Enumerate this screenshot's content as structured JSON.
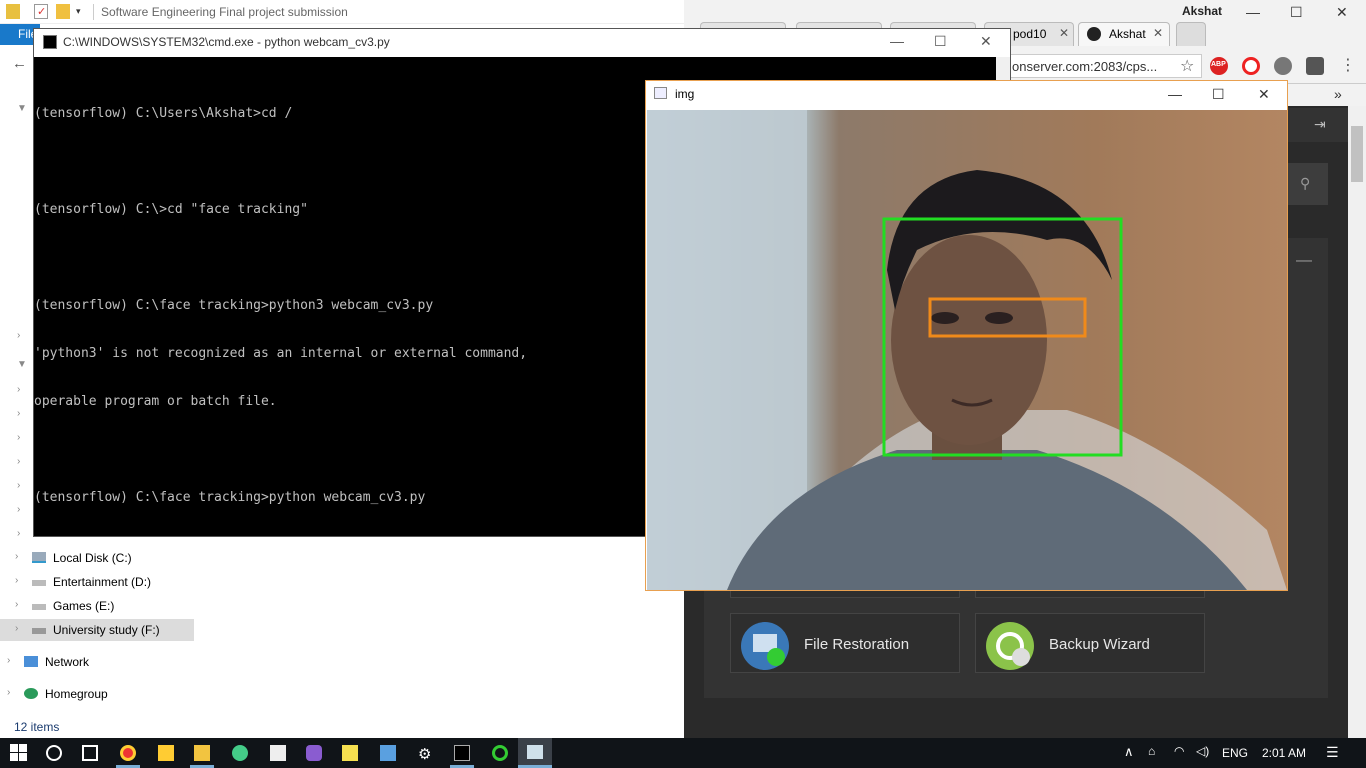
{
  "explorer": {
    "title": "Software Engineering Final project submission",
    "file_tab": "File",
    "status": "12 items",
    "nav": [
      {
        "label": "Local Disk (C:)"
      },
      {
        "label": "Entertainment (D:)"
      },
      {
        "label": "Games (E:)"
      },
      {
        "label": "University study (F:)"
      },
      {
        "label": "Network"
      },
      {
        "label": "Homegroup"
      }
    ]
  },
  "chrome": {
    "profile": "Akshat",
    "tabs": [
      {
        "label": "pod10"
      },
      {
        "label": "Akshat"
      }
    ],
    "address": "onserver.com:2083/cps...",
    "extensions": [
      "ABP"
    ],
    "overflow": "»",
    "cards": [
      {
        "label": "File Restoration",
        "icon": "file-restoration-icon"
      },
      {
        "label": "Backup Wizard",
        "icon": "backup-wizard-icon"
      }
    ]
  },
  "cmd": {
    "title": "C:\\WINDOWS\\SYSTEM32\\cmd.exe - python  webcam_cv3.py",
    "lines": [
      "(tensorflow) C:\\Users\\Akshat>cd /",
      "",
      "(tensorflow) C:\\>cd \"face tracking\"",
      "",
      "(tensorflow) C:\\face tracking>python3 webcam_cv3.py",
      "'python3' is not recognized as an internal or external command,",
      "operable program or batch file.",
      "",
      "(tensorflow) C:\\face tracking>python webcam_cv3.py"
    ]
  },
  "img_window": {
    "title": "img",
    "face_box_color": "#22dd22",
    "eye_box_color": "#f08a1a"
  },
  "taskbar": {
    "lang": "ENG",
    "time": "2:01 AM"
  }
}
